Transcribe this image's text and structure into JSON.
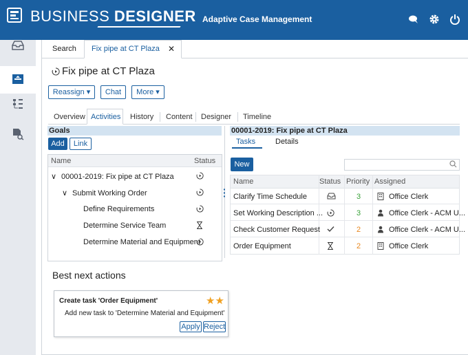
{
  "header": {
    "brand_light": "BUSINESS ",
    "brand_bold": "DESIGNER",
    "app_name": "Adaptive Case Management",
    "icons": [
      "chat-bubble-icon",
      "gear-icon",
      "power-icon"
    ]
  },
  "sidebar": {
    "items": [
      {
        "icon": "inbox-icon",
        "active": false
      },
      {
        "icon": "cases-icon",
        "active": true
      },
      {
        "icon": "hierarchy-icon",
        "active": false
      },
      {
        "icon": "document-search-icon",
        "active": false
      }
    ]
  },
  "tabs": {
    "search_label": "Search",
    "case_tab_label": "Fix pipe at CT Plaza",
    "close_glyph": "✕"
  },
  "case": {
    "title": "Fix pipe at CT Plaza",
    "status_icon": "in-progress-icon"
  },
  "actions": {
    "reassign_label": "Reassign ▾",
    "chat_label": "Chat",
    "more_label": "More ▾"
  },
  "subtabs": {
    "overview": "Overview",
    "activities": "Activities",
    "history": "History",
    "content": "Content",
    "designer": "Designer",
    "timeline": "Timeline"
  },
  "goals": {
    "heading": "Goals",
    "add_label": "Add",
    "link_label": "Link",
    "col_name": "Name",
    "col_status": "Status",
    "rows": [
      {
        "expander": "∨",
        "label": "00001-2019: Fix pipe at CT Plaza",
        "status": "in-progress-icon"
      },
      {
        "expander": "∨",
        "label": "Submit Working Order",
        "status": "in-progress-icon"
      },
      {
        "expander": "",
        "label": "Define Requirements",
        "status": "in-progress-icon"
      },
      {
        "expander": "",
        "label": "Determine Service Team",
        "status": "waiting-icon"
      },
      {
        "expander": "",
        "label": "Determine Material and Equipment",
        "status": "in-progress-icon"
      }
    ]
  },
  "detail": {
    "heading": "00001-2019: Fix pipe at CT Plaza",
    "tab_tasks": "Tasks",
    "tab_details": "Details",
    "new_label": "New",
    "search_placeholder": "",
    "col_name": "Name",
    "col_status": "Status",
    "col_priority": "Priority",
    "col_assigned": "Assigned",
    "tasks": [
      {
        "name": "Clarify Time Schedule",
        "status": "inbox-icon",
        "priority": "3",
        "priority_color": "#3aa23a",
        "assigned_icon": "building-icon",
        "assigned": "Office Clerk"
      },
      {
        "name": "Set Working Description ...",
        "status": "in-progress-icon",
        "priority": "3",
        "priority_color": "#3aa23a",
        "assigned_icon": "person-icon",
        "assigned": "Office Clerk - ACM U..."
      },
      {
        "name": "Check Customer Request",
        "status": "check-icon",
        "priority": "2",
        "priority_color": "#e8871e",
        "assigned_icon": "person-icon",
        "assigned": "Office Clerk - ACM U..."
      },
      {
        "name": "Order Equipment",
        "status": "waiting-icon",
        "priority": "2",
        "priority_color": "#e8871e",
        "assigned_icon": "building-icon",
        "assigned": "Office Clerk"
      }
    ]
  },
  "best_next": {
    "heading": "Best next actions",
    "card_title": "Create task 'Order Equipment'",
    "stars": "★★",
    "card_desc": "Add new task to 'Determine Material and Equipment'",
    "apply_label": "Apply",
    "reject_label": "Reject"
  },
  "colors": {
    "brand": "#1a5fa0",
    "panel_header": "#d3e3f1",
    "priority_green": "#3aa23a",
    "priority_orange": "#e8871e",
    "star": "#f0a020"
  }
}
